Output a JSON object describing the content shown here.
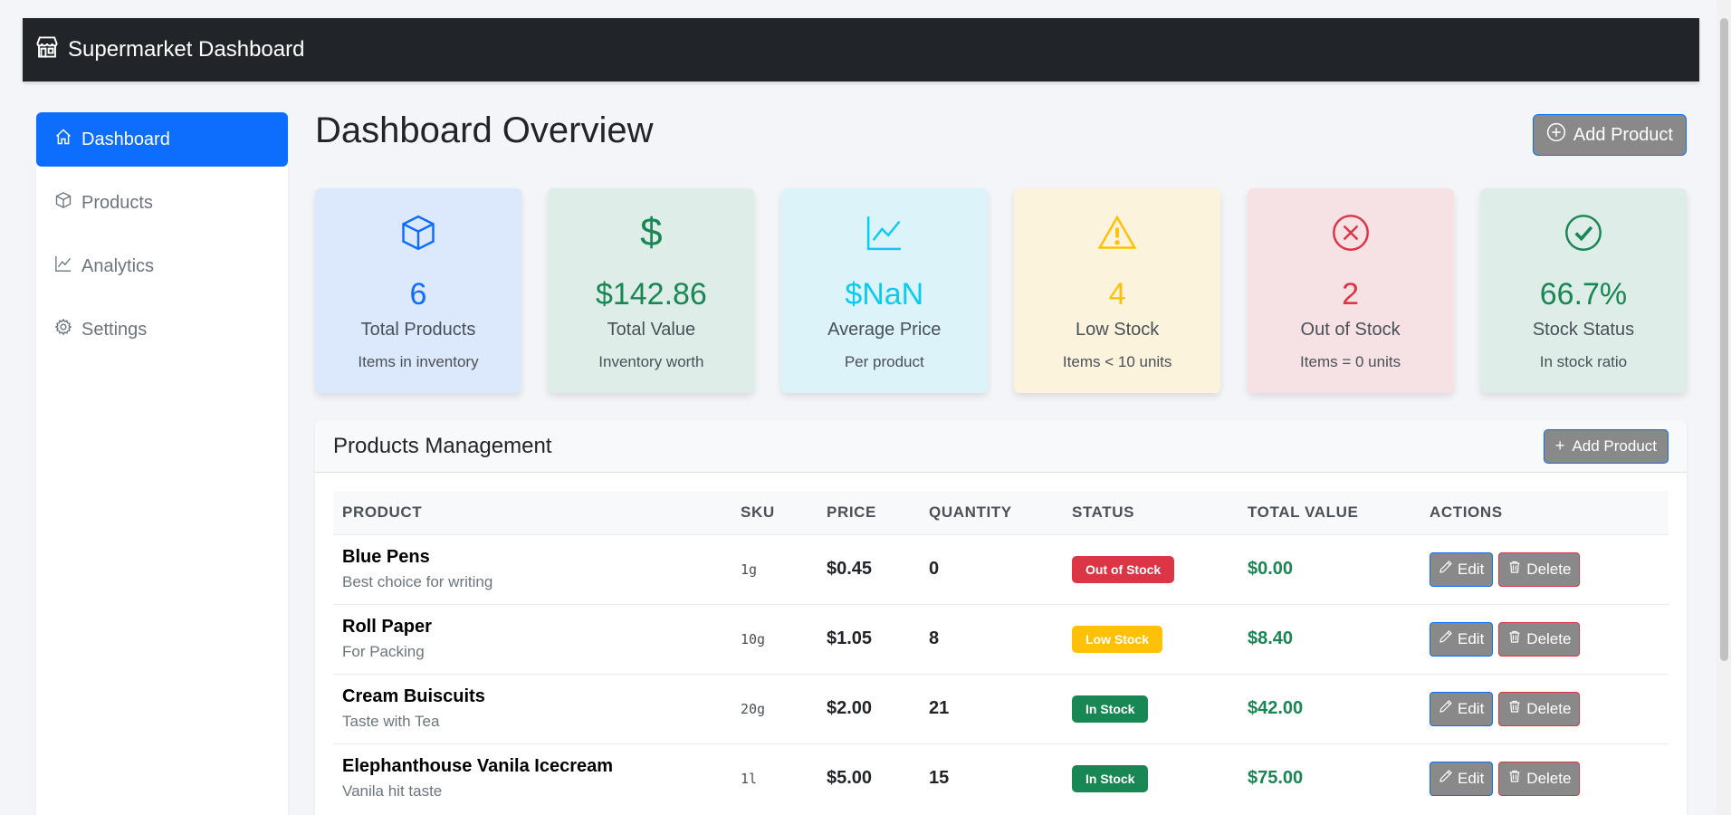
{
  "navbar": {
    "brand": "Supermarket Dashboard",
    "icon": "shop-icon"
  },
  "sidebar": {
    "items": [
      {
        "label": "Dashboard",
        "icon": "house-icon",
        "active": true
      },
      {
        "label": "Products",
        "icon": "box-icon",
        "active": false
      },
      {
        "label": "Analytics",
        "icon": "graph-up-icon",
        "active": false
      },
      {
        "label": "Settings",
        "icon": "gear-icon",
        "active": false
      }
    ]
  },
  "main": {
    "title": "Dashboard Overview",
    "add_product_label": "Add Product"
  },
  "stats": [
    {
      "value": "6",
      "label": "Total Products",
      "sub": "Items in inventory",
      "icon": "box-icon",
      "color": "#0d6efd",
      "bg": "#dce8fb"
    },
    {
      "value": "$142.86",
      "label": "Total Value",
      "sub": "Inventory worth",
      "icon": "dollar-icon",
      "color": "#198754",
      "bg": "#dfede8"
    },
    {
      "value": "$NaN",
      "label": "Average Price",
      "sub": "Per product",
      "icon": "graph-up-icon",
      "color": "#0dcaf0",
      "bg": "#dcf3f9"
    },
    {
      "value": "4",
      "label": "Low Stock",
      "sub": "Items < 10 units",
      "icon": "warning-icon",
      "color": "#ffc107",
      "bg": "#fbf3dc"
    },
    {
      "value": "2",
      "label": "Out of Stock",
      "sub": "Items = 0 units",
      "icon": "x-circle-icon",
      "color": "#dc3545",
      "bg": "#f6e1e4"
    },
    {
      "value": "66.7%",
      "label": "Stock Status",
      "sub": "In stock ratio",
      "icon": "check-circle-icon",
      "color": "#198754",
      "bg": "#dfede8"
    }
  ],
  "products_panel": {
    "title": "Products Management",
    "add_label": "Add Product",
    "columns": [
      "PRODUCT",
      "SKU",
      "PRICE",
      "QUANTITY",
      "STATUS",
      "TOTAL VALUE",
      "ACTIONS"
    ],
    "edit_label": "Edit",
    "delete_label": "Delete",
    "rows": [
      {
        "name": "Blue Pens",
        "desc": "Best choice for writing",
        "sku": "1g",
        "price": "$0.45",
        "qty": "0",
        "status": "Out of Stock",
        "status_type": "out",
        "total": "$0.00"
      },
      {
        "name": "Roll Paper",
        "desc": "For Packing",
        "sku": "10g",
        "price": "$1.05",
        "qty": "8",
        "status": "Low Stock",
        "status_type": "low",
        "total": "$8.40"
      },
      {
        "name": "Cream Buiscuits",
        "desc": "Taste with Tea",
        "sku": "20g",
        "price": "$2.00",
        "qty": "21",
        "status": "In Stock",
        "status_type": "in",
        "total": "$42.00"
      },
      {
        "name": "Elephanthouse Vanila Icecream",
        "desc": "Vanila hit taste",
        "sku": "1l",
        "price": "$5.00",
        "qty": "15",
        "status": "In Stock",
        "status_type": "in",
        "total": "$75.00"
      }
    ]
  }
}
